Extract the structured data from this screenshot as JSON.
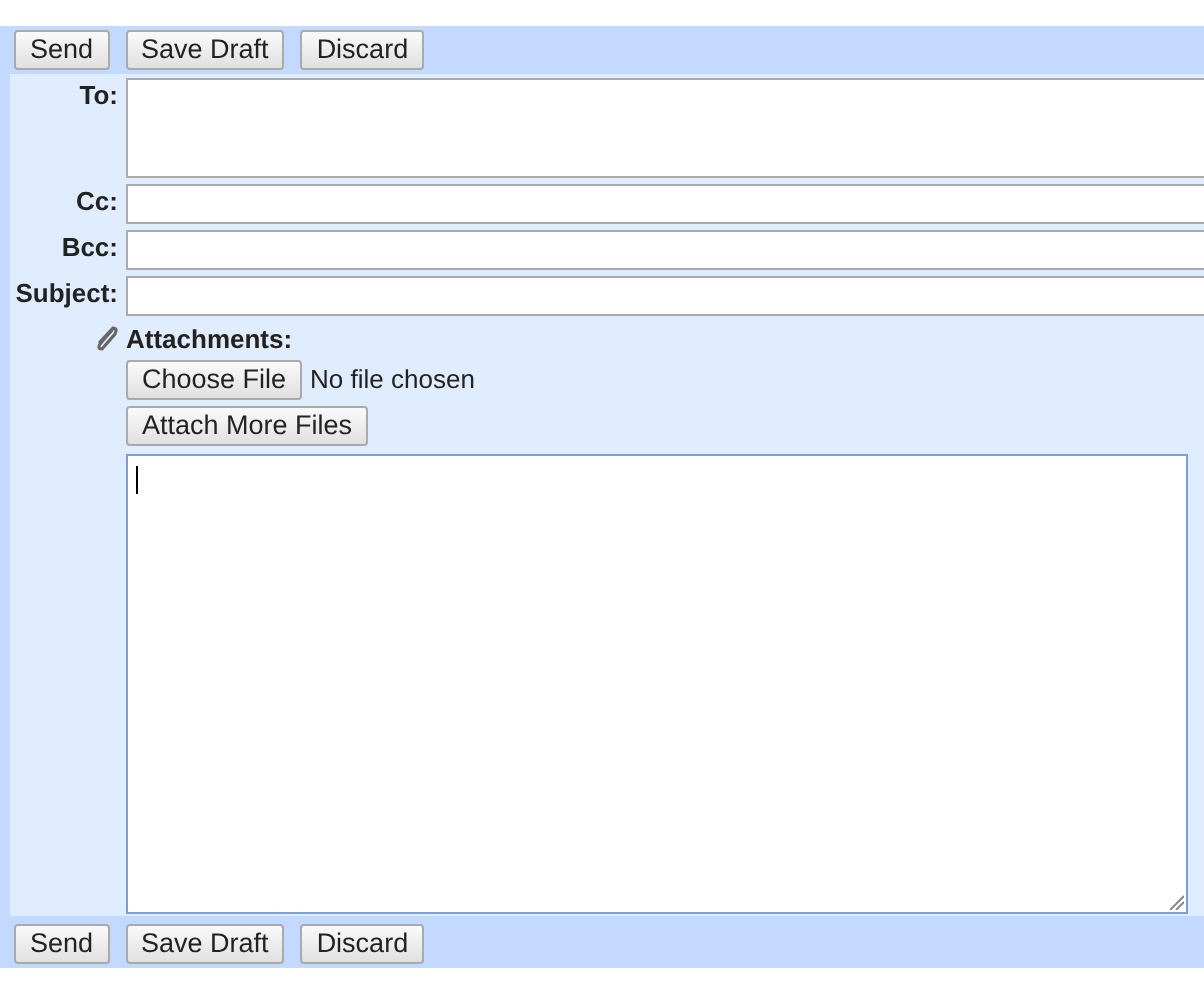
{
  "top_toolbar": {
    "buttons": [
      "Send",
      "Save Draft",
      "Discard"
    ]
  },
  "fields": [
    {
      "label": "To:",
      "kind": "multiline"
    },
    {
      "label": "Cc:",
      "kind": "line"
    },
    {
      "label": "Bcc:",
      "kind": "line"
    },
    {
      "label": "Subject:",
      "kind": "line"
    }
  ],
  "attachments": {
    "label": "Attachments:",
    "choose_button": "Choose File",
    "file_status": "No file chosen",
    "more_button": "Attach More Files"
  },
  "bottom_toolbar": {
    "buttons": [
      "Send",
      "Save Draft",
      "Discard"
    ]
  }
}
